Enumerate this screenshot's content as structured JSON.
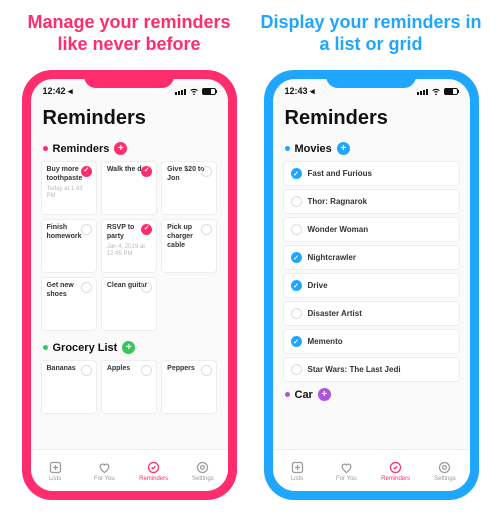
{
  "left": {
    "headline": "Manage your reminders like never before",
    "status_time": "12:42 ◂",
    "page_title": "Reminders",
    "sections": [
      {
        "name": "Reminders",
        "color": "pink",
        "layout": "grid",
        "items": [
          {
            "title": "Buy more toothpaste",
            "sub": "Today at 1:43 PM",
            "checked": true
          },
          {
            "title": "Walk the dog",
            "sub": "",
            "checked": true
          },
          {
            "title": "Give $20 to Jon",
            "sub": "",
            "checked": false
          },
          {
            "title": "Finish homework",
            "sub": "",
            "checked": false
          },
          {
            "title": "RSVP to party",
            "sub": "Jan 4, 2019 at 12:45 PM",
            "checked": true
          },
          {
            "title": "Pick up charger cable",
            "sub": "",
            "checked": false
          },
          {
            "title": "Get new shoes",
            "sub": "",
            "checked": false
          },
          {
            "title": "Clean guitar",
            "sub": "",
            "checked": false
          }
        ]
      },
      {
        "name": "Grocery List",
        "color": "green",
        "layout": "grid",
        "items": [
          {
            "title": "Bananas",
            "sub": "",
            "checked": false
          },
          {
            "title": "Apples",
            "sub": "",
            "checked": false
          },
          {
            "title": "Peppers",
            "sub": "",
            "checked": false
          }
        ]
      }
    ]
  },
  "right": {
    "headline": "Display your reminders in a list or grid",
    "status_time": "12:43 ◂",
    "page_title": "Reminders",
    "sections": [
      {
        "name": "Movies",
        "color": "blue",
        "layout": "list",
        "items": [
          {
            "title": "Fast and Furious",
            "checked": true
          },
          {
            "title": "Thor: Ragnarok",
            "checked": false
          },
          {
            "title": "Wonder Woman",
            "checked": false
          },
          {
            "title": "Nightcrawler",
            "checked": true
          },
          {
            "title": "Drive",
            "checked": true
          },
          {
            "title": "Disaster Artist",
            "checked": false
          },
          {
            "title": "Memento",
            "checked": true
          },
          {
            "title": "Star Wars: The Last Jedi",
            "checked": false
          }
        ]
      },
      {
        "name": "Car",
        "color": "purple",
        "layout": "list",
        "items": []
      }
    ]
  },
  "tabs": [
    {
      "label": "Lists",
      "icon": "square-plus-icon",
      "active": false
    },
    {
      "label": "For You",
      "icon": "heart-icon",
      "active": false
    },
    {
      "label": "Reminders",
      "icon": "check-circle-icon",
      "active": true
    },
    {
      "label": "Settings",
      "icon": "gear-icon",
      "active": false
    }
  ]
}
